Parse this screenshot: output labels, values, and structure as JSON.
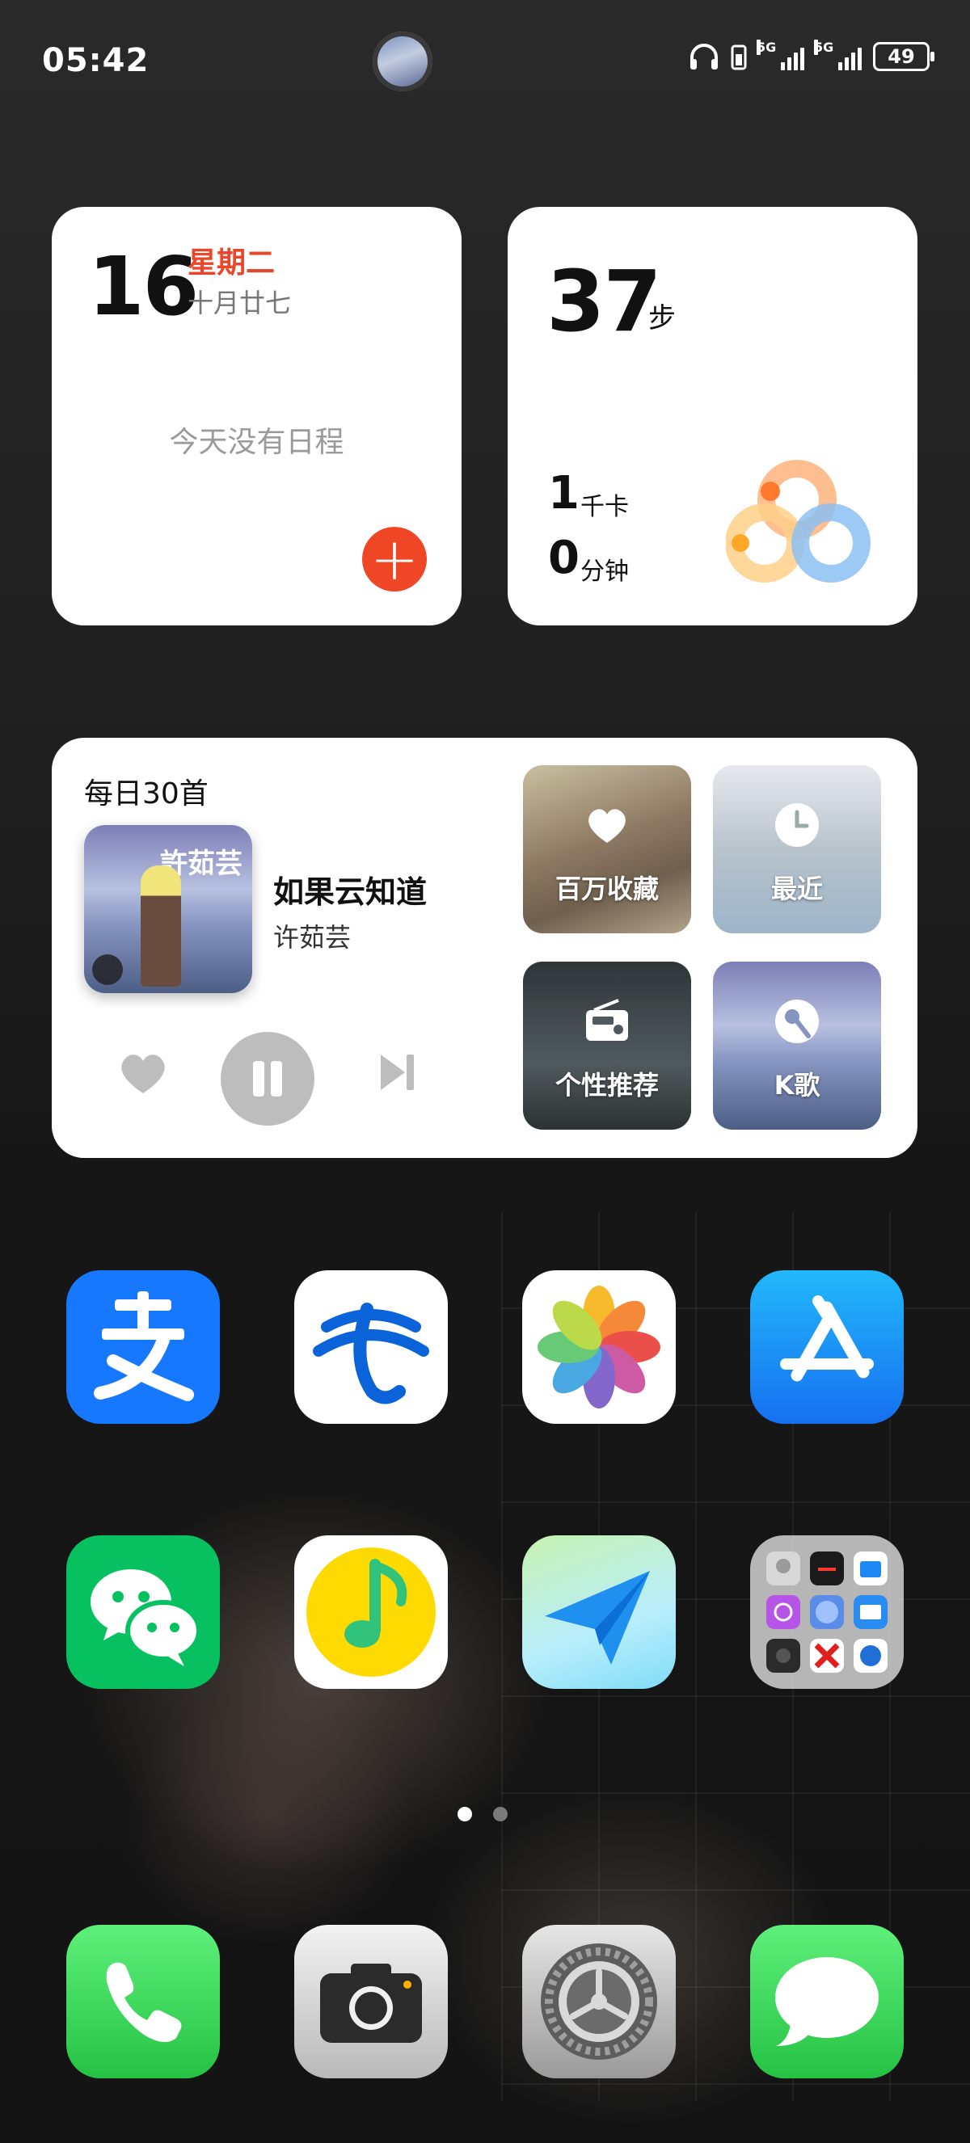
{
  "status_bar": {
    "time": "05:42",
    "network_1": "5G",
    "network_2": "5G",
    "battery": "49"
  },
  "calendar_widget": {
    "day": "16",
    "weekday": "星期二",
    "lunar_date": "十月廿七",
    "empty_text": "今天没有日程",
    "accent_color": "#EF4626"
  },
  "fitness_widget": {
    "steps": "37",
    "steps_unit": "步",
    "calories": "1",
    "calories_unit": "千卡",
    "minutes": "0",
    "minutes_unit": "分钟"
  },
  "music_widget": {
    "header": "每日30首",
    "song_title": "如果云知道",
    "artist": "许茹芸",
    "cover_text": "許茹芸",
    "controls": [
      "heart-icon",
      "pause-icon",
      "next-icon"
    ],
    "tiles": [
      {
        "label": "百万收藏",
        "icon": "heart-icon"
      },
      {
        "label": "最近",
        "icon": "clock-icon"
      },
      {
        "label": "个性推荐",
        "icon": "radio-icon"
      },
      {
        "label": "K歌",
        "icon": "karaoke-icon"
      }
    ]
  },
  "apps_row_1": [
    "alipay",
    "china-telecom",
    "photos",
    "app-store"
  ],
  "apps_row_2": [
    "wechat",
    "qq-music",
    "feishu-direct",
    "folder"
  ],
  "dock": [
    "phone",
    "camera",
    "settings",
    "messages"
  ],
  "page_indicator": {
    "pages": 2,
    "current": 1
  }
}
